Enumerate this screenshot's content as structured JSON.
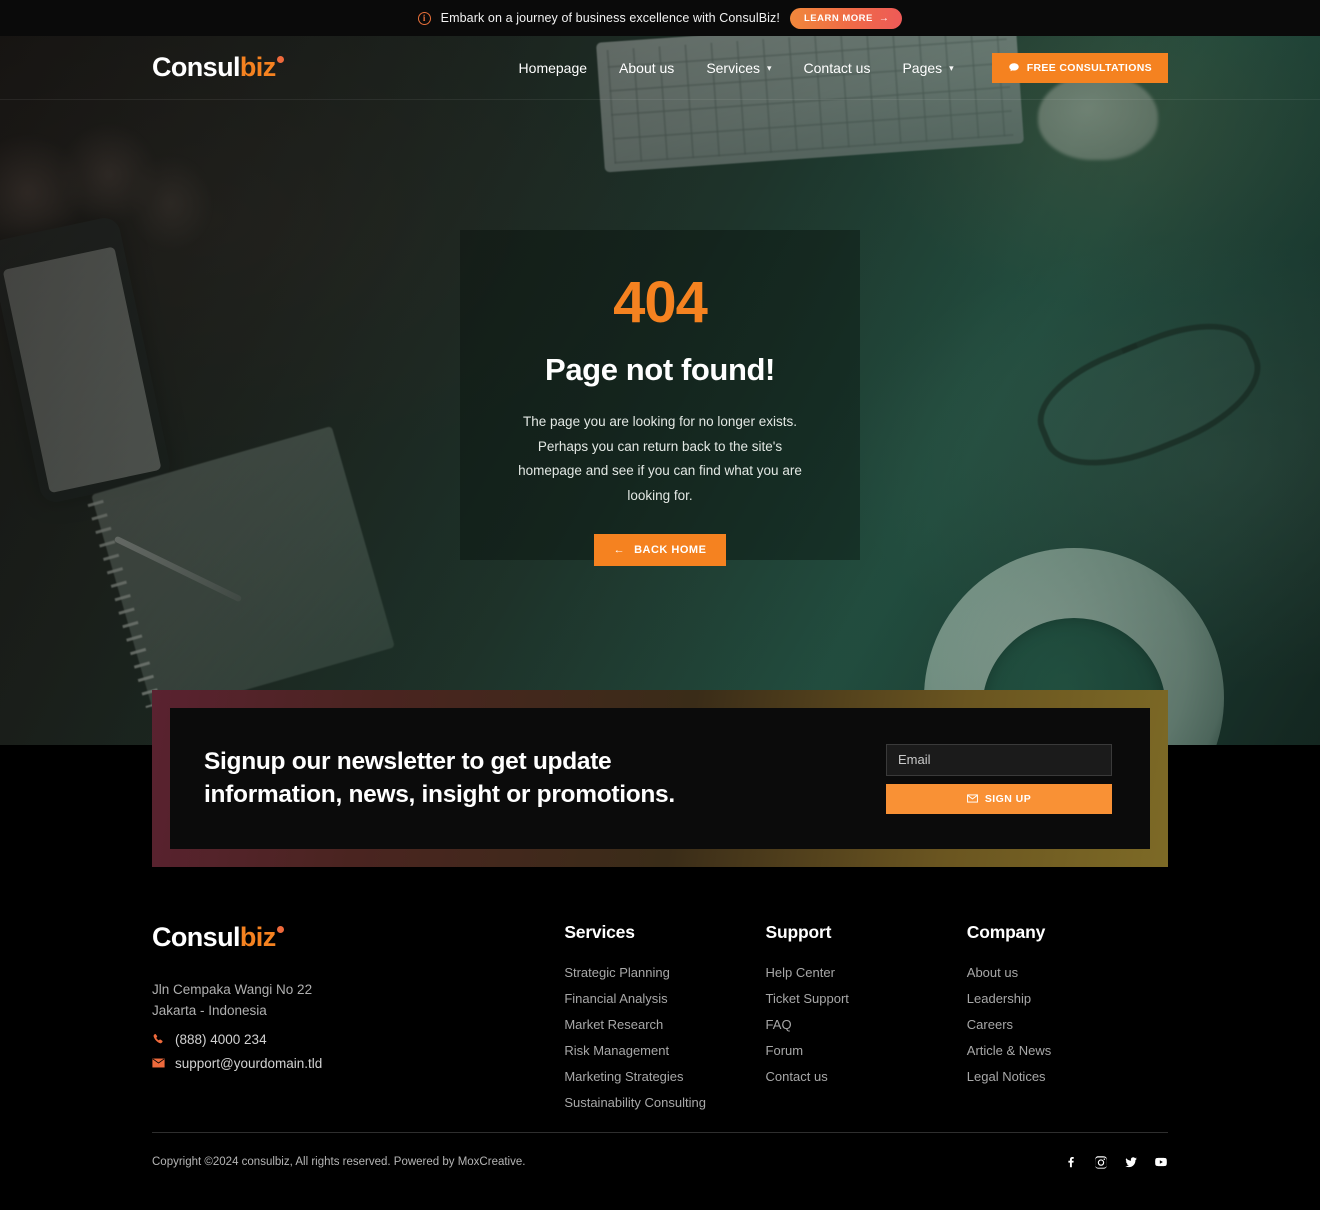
{
  "announcement": {
    "icon": "info-circle-icon",
    "text": "Embark on a journey of business excellence with ConsulBiz!",
    "button_label": "LEARN MORE",
    "button_arrow": "→"
  },
  "header": {
    "logo": {
      "part1": "Consul",
      "part2": "biz"
    },
    "nav": [
      {
        "label": "Homepage",
        "has_dropdown": false
      },
      {
        "label": "About us",
        "has_dropdown": false
      },
      {
        "label": "Services",
        "has_dropdown": true
      },
      {
        "label": "Contact us",
        "has_dropdown": false
      },
      {
        "label": "Pages",
        "has_dropdown": true
      }
    ],
    "cta_label": "FREE CONSULTATIONS",
    "chevron": "⌵"
  },
  "notfound": {
    "code": "404",
    "title": "Page not found!",
    "description": "The page you are looking for no longer exists. Perhaps you can return back to the site's homepage and see if you can find what you are looking for.",
    "button_label": "BACK HOME",
    "button_arrow": "←"
  },
  "newsletter": {
    "heading_line1": "Signup our newsletter to get update",
    "heading_line2": "information, news, insight or promotions.",
    "input_placeholder": "Email",
    "input_value": "",
    "button_label": "SIGN UP"
  },
  "footer": {
    "logo": {
      "part1": "Consul",
      "part2": "biz"
    },
    "address_line1": "Jln Cempaka Wangi No 22",
    "address_line2": "Jakarta - Indonesia",
    "phone": "(888) 4000 234",
    "email": "support@yourdomain.tld",
    "columns": [
      {
        "title": "Services",
        "links": [
          "Strategic Planning",
          "Financial Analysis",
          "Market Research",
          "Risk Management",
          "Marketing Strategies",
          "Sustainability Consulting"
        ]
      },
      {
        "title": "Support",
        "links": [
          "Help Center",
          "Ticket Support",
          "FAQ",
          "Forum",
          "Contact us"
        ]
      },
      {
        "title": "Company",
        "links": [
          "About us",
          "Leadership",
          "Careers",
          "Article & News",
          "Legal Notices"
        ]
      }
    ],
    "copyright": "Copyright ©2024 consulbiz, All rights reserved. Powered by MoxCreative.",
    "socials": [
      "facebook-icon",
      "instagram-icon",
      "twitter-icon",
      "youtube-icon"
    ]
  },
  "colors": {
    "accent_orange": "#f58220",
    "banner_gradient_start": "#f1883b",
    "banner_gradient_end": "#ee5a58",
    "footer_bg": "#000000",
    "hero_tint": "#1e3c33"
  }
}
